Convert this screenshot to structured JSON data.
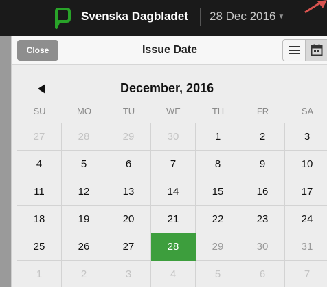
{
  "header": {
    "publication": "Svenska Dagbladet",
    "date_selector": "28 Dec 2016",
    "colors": {
      "bar": "#1a1a1a",
      "logo": "#29a329",
      "pointer": "#d9534f"
    }
  },
  "panel": {
    "close_label": "Close",
    "title": "Issue Date",
    "view_buttons": [
      "list-icon",
      "calendar-icon"
    ]
  },
  "calendar": {
    "month_label": "December, 2016",
    "weekdays": [
      "SU",
      "MO",
      "TU",
      "WE",
      "TH",
      "FR",
      "SA"
    ],
    "selected_day": "28",
    "selected_color": "#3d9e3d",
    "weeks": [
      [
        [
          "27",
          "other"
        ],
        [
          "28",
          "other"
        ],
        [
          "29",
          "other"
        ],
        [
          "30",
          "other"
        ],
        [
          "1",
          "current"
        ],
        [
          "2",
          "current"
        ],
        [
          "3",
          "current"
        ]
      ],
      [
        [
          "4",
          "current"
        ],
        [
          "5",
          "current"
        ],
        [
          "6",
          "current"
        ],
        [
          "7",
          "current"
        ],
        [
          "8",
          "current"
        ],
        [
          "9",
          "current"
        ],
        [
          "10",
          "current"
        ]
      ],
      [
        [
          "11",
          "current"
        ],
        [
          "12",
          "current"
        ],
        [
          "13",
          "current"
        ],
        [
          "14",
          "current"
        ],
        [
          "15",
          "current"
        ],
        [
          "16",
          "current"
        ],
        [
          "17",
          "current"
        ]
      ],
      [
        [
          "18",
          "current"
        ],
        [
          "19",
          "current"
        ],
        [
          "20",
          "current"
        ],
        [
          "21",
          "current"
        ],
        [
          "22",
          "current"
        ],
        [
          "23",
          "current"
        ],
        [
          "24",
          "current"
        ]
      ],
      [
        [
          "25",
          "current"
        ],
        [
          "26",
          "current"
        ],
        [
          "27",
          "current"
        ],
        [
          "28",
          "selected"
        ],
        [
          "29",
          "future"
        ],
        [
          "30",
          "future"
        ],
        [
          "31",
          "future"
        ]
      ],
      [
        [
          "1",
          "other"
        ],
        [
          "2",
          "other"
        ],
        [
          "3",
          "other"
        ],
        [
          "4",
          "other"
        ],
        [
          "5",
          "other"
        ],
        [
          "6",
          "other"
        ],
        [
          "7",
          "other"
        ]
      ]
    ]
  }
}
